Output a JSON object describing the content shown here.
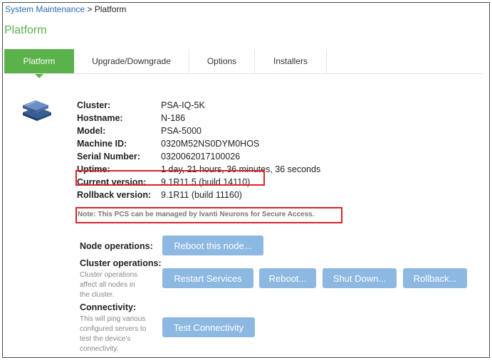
{
  "breadcrumb": {
    "parent": "System Maintenance",
    "separator": " > ",
    "current": "Platform"
  },
  "page_title": "Platform",
  "tabs": [
    {
      "label": "Platform",
      "active": true
    },
    {
      "label": "Upgrade/Downgrade",
      "active": false
    },
    {
      "label": "Options",
      "active": false
    },
    {
      "label": "Installers",
      "active": false
    }
  ],
  "icon": "server-cluster-icon",
  "info": [
    {
      "key": "Cluster:",
      "value": "PSA-IQ-5K"
    },
    {
      "key": "Hostname:",
      "value": "N-186"
    },
    {
      "key": "Model:",
      "value": "PSA-5000"
    },
    {
      "key": "Machine ID:",
      "value": "0320M52NS0DYM0HOS"
    },
    {
      "key": "Serial Number:",
      "value": "0320062017100026"
    },
    {
      "key": "Uptime:",
      "value": "1 day, 21 hours, 36 minutes, 36 seconds"
    },
    {
      "key": "Current version:",
      "value": "9.1R11.5 (build 14110)"
    },
    {
      "key": "Rollback version:",
      "value": "9.1R11 (build 11160)"
    }
  ],
  "note": "Note: This PCS can be managed by Ivanti Neurons for Secure Access.",
  "node_ops": {
    "label": "Node operations:",
    "reboot_node": "Reboot this node..."
  },
  "cluster_ops": {
    "label": "Cluster operations:",
    "description": [
      "Cluster operations",
      "affect all nodes in",
      "the cluster."
    ],
    "restart": "Restart Services",
    "reboot": "Reboot...",
    "shutdown": "Shut Down...",
    "rollback": "Rollback..."
  },
  "connectivity": {
    "label": "Connectivity:",
    "description": [
      "This will ping various",
      "configured servers to",
      "test the device's",
      "connectivity."
    ],
    "test": "Test Connectivity"
  },
  "colors": {
    "accent": "#5cb24a",
    "link": "#2a6cb5",
    "button": "#8db8e2",
    "highlight": "#d9242b"
  }
}
